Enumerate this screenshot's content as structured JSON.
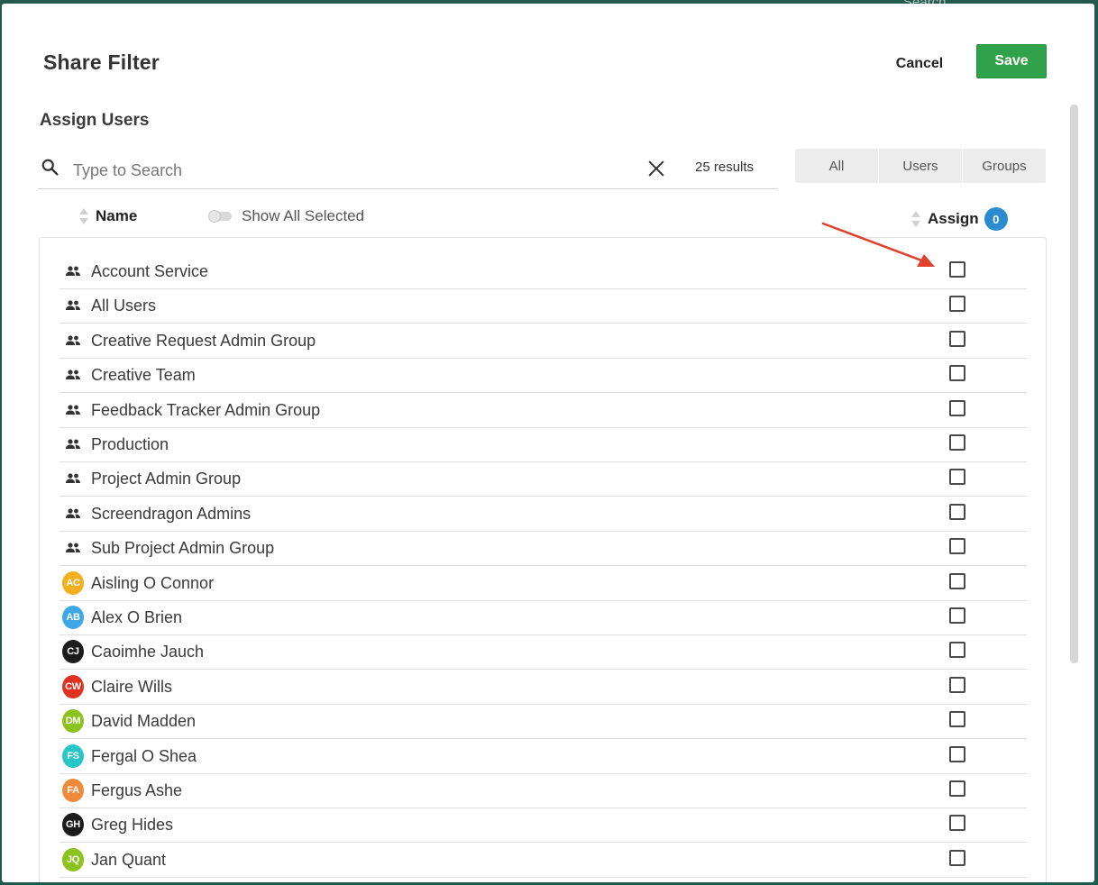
{
  "background": {
    "ghost_text": "Search..."
  },
  "dialog": {
    "title": "Share Filter",
    "cancel_label": "Cancel",
    "save_label": "Save"
  },
  "section": {
    "title": "Assign Users"
  },
  "search": {
    "placeholder": "Type to Search",
    "value": "",
    "results": "25 results"
  },
  "filters": [
    {
      "label": "All"
    },
    {
      "label": "Users"
    },
    {
      "label": "Groups"
    }
  ],
  "columns": {
    "name": "Name",
    "show_all_selected": "Show All Selected",
    "assign": "Assign",
    "assign_count": "0"
  },
  "rows": [
    {
      "label": "Account Service",
      "type": "group"
    },
    {
      "label": "All Users",
      "type": "group"
    },
    {
      "label": "Creative Request Admin Group",
      "type": "group"
    },
    {
      "label": "Creative Team",
      "type": "group"
    },
    {
      "label": "Feedback Tracker Admin Group",
      "type": "group"
    },
    {
      "label": "Production",
      "type": "group"
    },
    {
      "label": "Project Admin Group",
      "type": "group"
    },
    {
      "label": "Screendragon Admins",
      "type": "group"
    },
    {
      "label": "Sub Project Admin Group",
      "type": "group"
    },
    {
      "label": "Aisling O Connor",
      "type": "user",
      "initials": "AC",
      "color": "#f2b01e"
    },
    {
      "label": "Alex O Brien",
      "type": "user",
      "initials": "AB",
      "color": "#3ea8e5"
    },
    {
      "label": "Caoimhe Jauch",
      "type": "user",
      "initials": "CJ",
      "color": "#1c1c1c"
    },
    {
      "label": "Claire Wills",
      "type": "user",
      "initials": "CW",
      "color": "#e0321f"
    },
    {
      "label": "David Madden",
      "type": "user",
      "initials": "DM",
      "color": "#8bc21c"
    },
    {
      "label": "Fergal O Shea",
      "type": "user",
      "initials": "FS",
      "color": "#27c6c9"
    },
    {
      "label": "Fergus Ashe",
      "type": "user",
      "initials": "FA",
      "color": "#ef8a3c"
    },
    {
      "label": "Greg Hides",
      "type": "user",
      "initials": "GH",
      "color": "#1c1c1c"
    },
    {
      "label": "Jan Quant",
      "type": "user",
      "initials": "JQ",
      "color": "#8bc21c"
    }
  ],
  "colors": {
    "save": "#2fa24a",
    "badge": "#2a8bd0",
    "arrow": "#e0412c"
  }
}
